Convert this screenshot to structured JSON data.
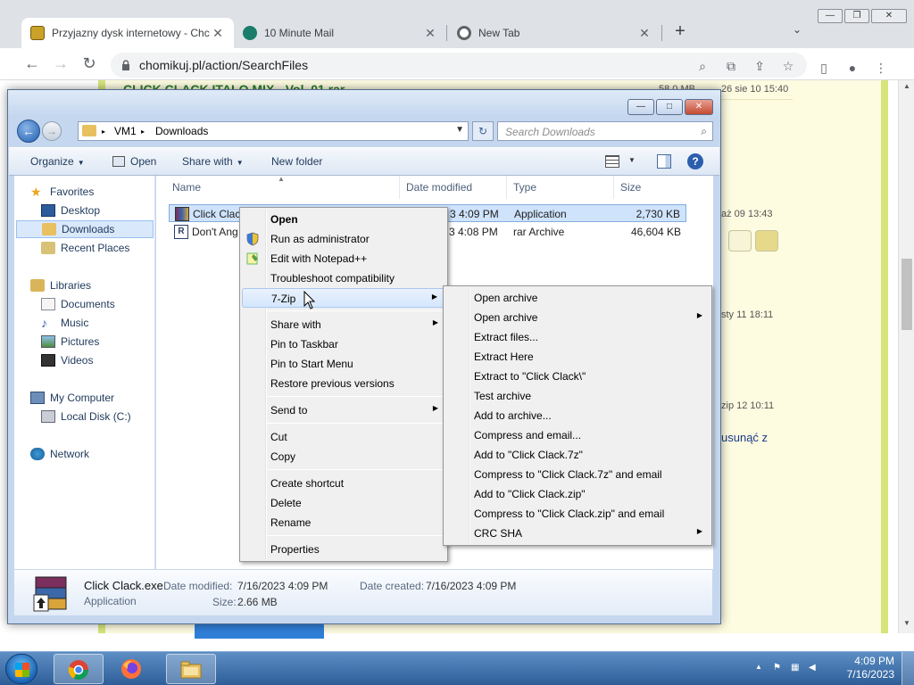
{
  "browser": {
    "tabs": [
      {
        "title": "Przyjazny dysk internetowy - Chc",
        "close": "✕"
      },
      {
        "title": "10 Minute Mail",
        "close": "✕"
      },
      {
        "title": "New Tab",
        "close": "✕"
      }
    ],
    "new_tab": "+",
    "tab_search": "⌄",
    "window_buttons": {
      "minimize": "—",
      "maximize": "❐",
      "close": "✕"
    },
    "nav": {
      "back": "←",
      "forward": "→",
      "reload": "↻"
    },
    "url": "chomikuj.pl/action/SearchFiles",
    "omnibox_icons": {
      "search": "⌕",
      "translate": "⧉",
      "share": "⇪",
      "bookmark": "☆",
      "sidebar": "▯",
      "profile": "●",
      "menu": "⋮"
    }
  },
  "page": {
    "top_link": "CLICK CLACK ITALO MIX - Vol. 01.rar",
    "top_size": "58,0 MB",
    "top_date": "26 sie 10 15:40",
    "side_dates": [
      "aż 09 13:43",
      "sty 11 18:11",
      "zip 12 10:11"
    ],
    "side_link": "usunąć z"
  },
  "explorer": {
    "title_buttons": {
      "minimize": "—",
      "maximize": "□",
      "close": "✕"
    },
    "back": "←",
    "forward": "→",
    "breadcrumb": [
      "VM1",
      "Downloads"
    ],
    "breadcrumb_sep": "▸",
    "refresh": "↻",
    "search_placeholder": "Search Downloads",
    "search_icon": "⌕",
    "commands": {
      "organize": "Organize",
      "open": "Open",
      "share_with": "Share with",
      "new_folder": "New folder",
      "help": "?"
    },
    "nav": {
      "favorites": "Favorites",
      "desktop": "Desktop",
      "downloads": "Downloads",
      "recent": "Recent Places",
      "libraries": "Libraries",
      "documents": "Documents",
      "music": "Music",
      "pictures": "Pictures",
      "videos": "Videos",
      "computer": "My Computer",
      "local_disk": "Local Disk (C:)",
      "network": "Network"
    },
    "columns": {
      "name": "Name",
      "date": "Date modified",
      "type": "Type",
      "size": "Size"
    },
    "files": [
      {
        "name": "Click Clack",
        "date": "3 4:09 PM",
        "type": "Application",
        "size": "2,730 KB"
      },
      {
        "name": "Don't Ang",
        "date": "3 4:08 PM",
        "type": "rar Archive",
        "size": "46,604 KB"
      }
    ],
    "details": {
      "filename": "Click Clack.exe",
      "kind": "Application",
      "date_modified_label": "Date modified:",
      "date_modified": "7/16/2023 4:09 PM",
      "date_created_label": "Date created:",
      "date_created": "7/16/2023 4:09 PM",
      "size_label": "Size:",
      "size": "2.66 MB"
    }
  },
  "context_menu": {
    "open": "Open",
    "run_admin": "Run as administrator",
    "edit_notepad": "Edit with Notepad++",
    "troubleshoot": "Troubleshoot compatibility",
    "sevenzip": "7-Zip",
    "share_with": "Share with",
    "pin_taskbar": "Pin to Taskbar",
    "pin_start": "Pin to Start Menu",
    "restore": "Restore previous versions",
    "send_to": "Send to",
    "cut": "Cut",
    "copy": "Copy",
    "create_shortcut": "Create shortcut",
    "delete": "Delete",
    "rename": "Rename",
    "properties": "Properties",
    "arrow": "▶"
  },
  "sevenzip_menu": {
    "open_archive": "Open archive",
    "open_archive_sub": "Open archive",
    "extract_files": "Extract files...",
    "extract_here": "Extract Here",
    "extract_to": "Extract to \"Click Clack\\\"",
    "test": "Test archive",
    "add": "Add to archive...",
    "compress_email": "Compress and email...",
    "add_7z": "Add to \"Click Clack.7z\"",
    "compress_7z_email": "Compress to \"Click Clack.7z\" and email",
    "add_zip": "Add to \"Click Clack.zip\"",
    "compress_zip_email": "Compress to \"Click Clack.zip\" and email",
    "crc": "CRC SHA",
    "arrow": "▶"
  },
  "taskbar": {
    "time": "4:09 PM",
    "date": "7/16/2023",
    "tray": {
      "up": "▲",
      "flag": "⚑",
      "network": "▦",
      "volume": "◀"
    }
  }
}
